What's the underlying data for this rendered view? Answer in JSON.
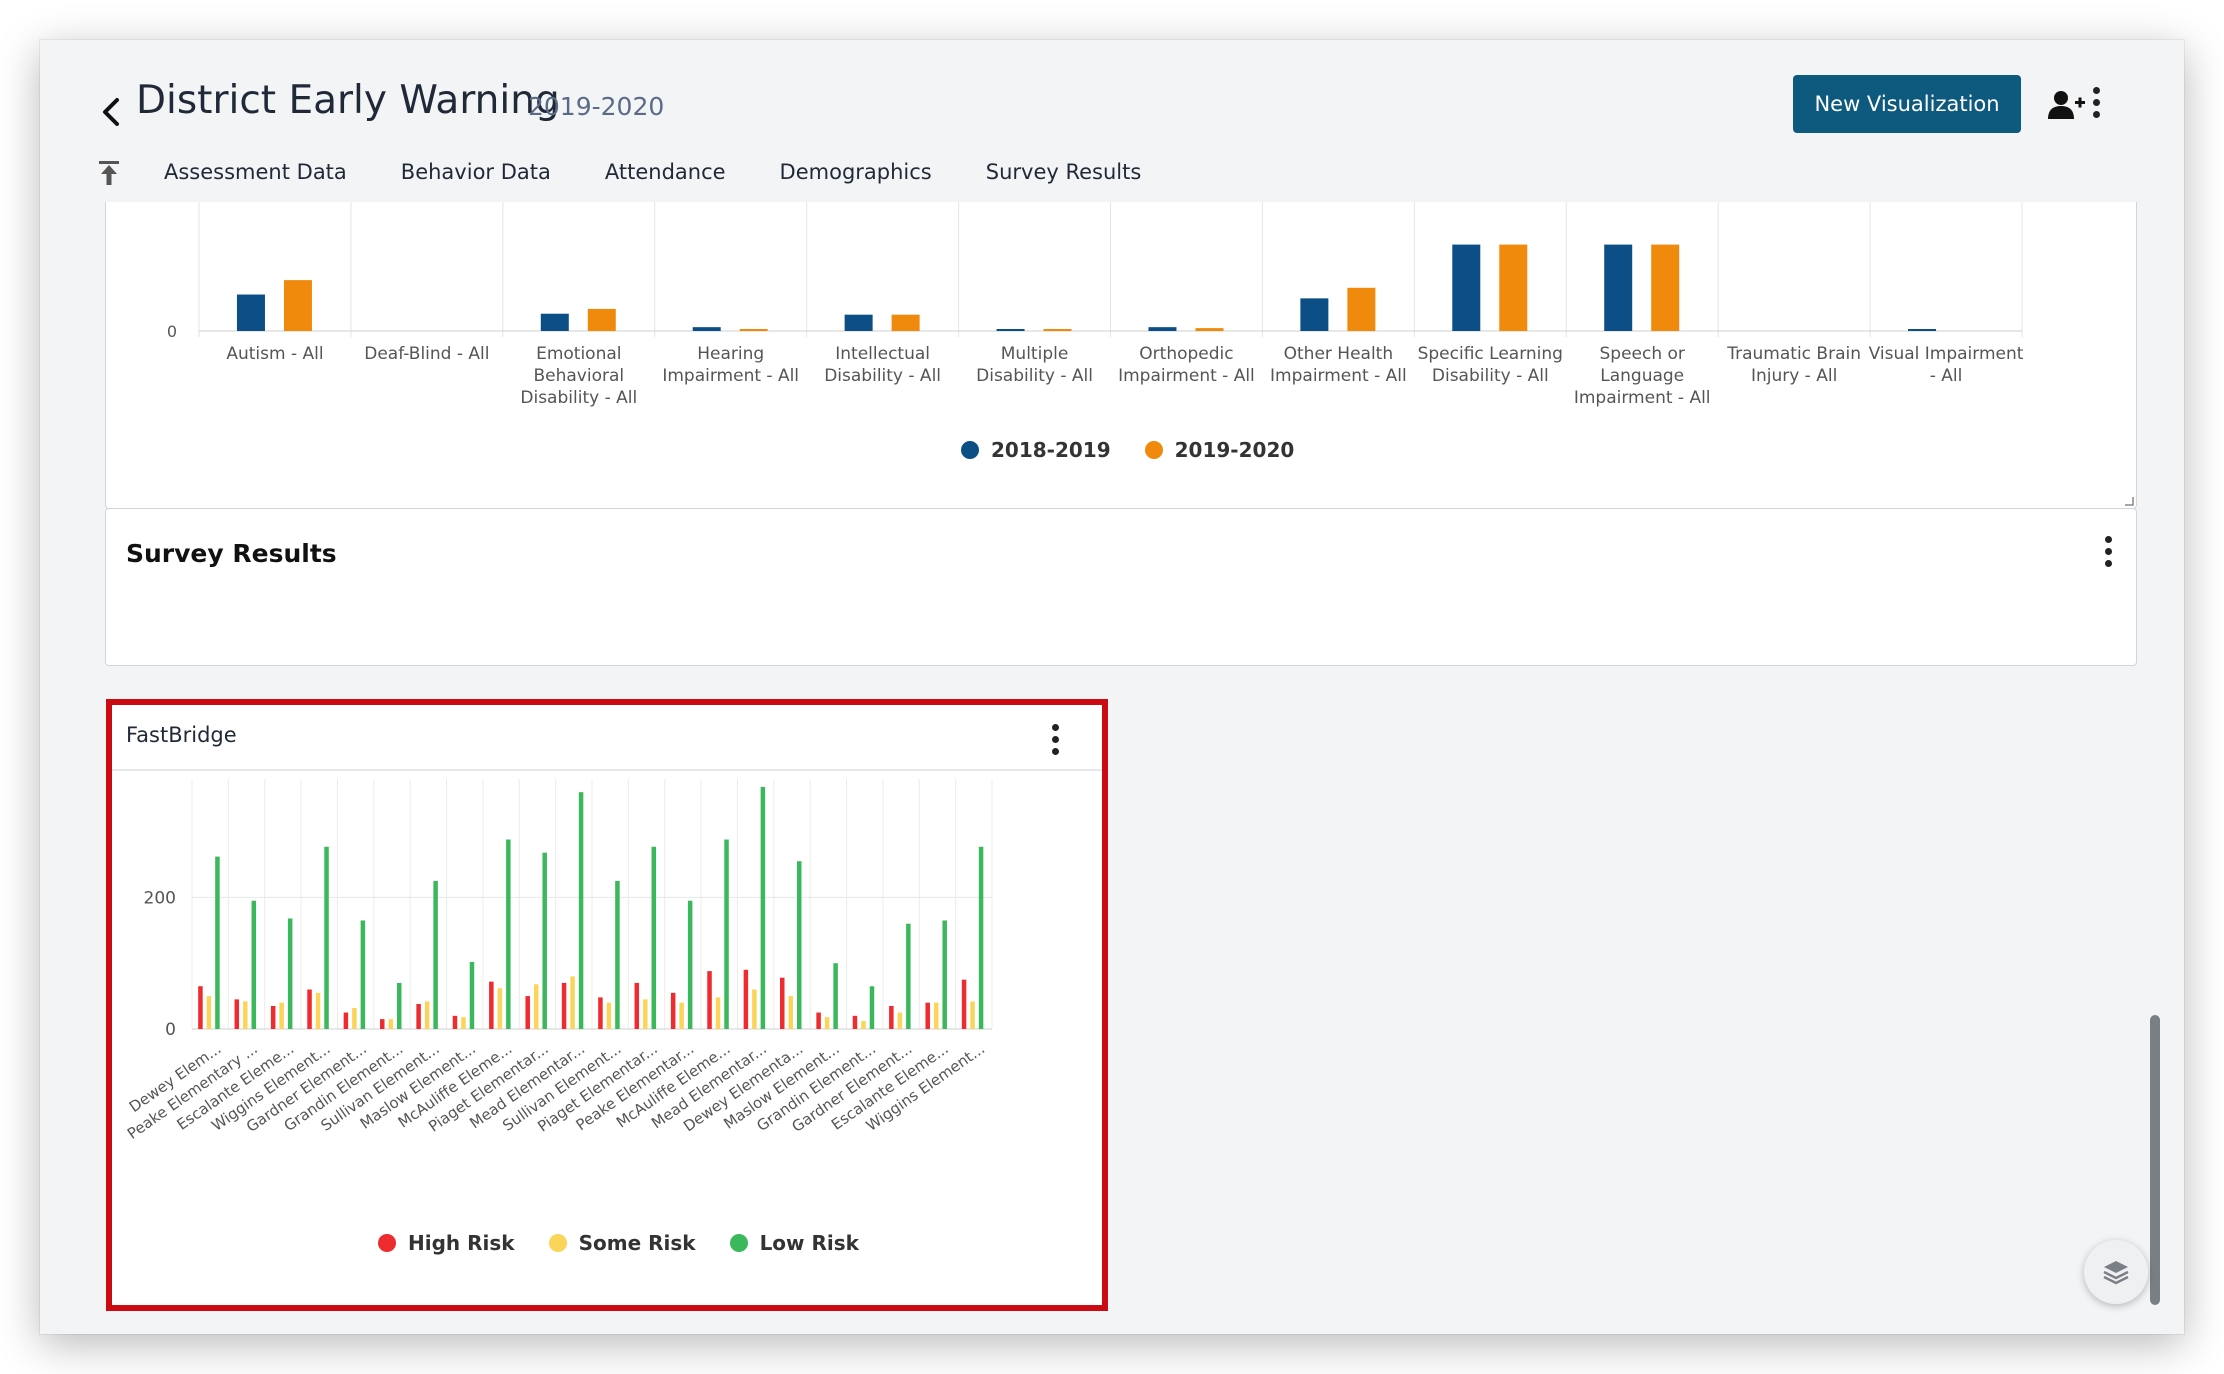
{
  "header": {
    "title": "District Early Warning",
    "subtitle": "2019-2020",
    "new_viz_label": "New Visualization"
  },
  "tabs": [
    {
      "label": "Assessment Data"
    },
    {
      "label": "Behavior Data"
    },
    {
      "label": "Attendance"
    },
    {
      "label": "Demographics"
    },
    {
      "label": "Survey Results"
    }
  ],
  "icons": {
    "back": "chevron-left-icon",
    "collapse": "collapse-up-icon",
    "add_user": "add-user-icon",
    "more": "kebab-menu-icon",
    "layers": "layers-icon"
  },
  "colors": {
    "primary_button": "#0d5a7e",
    "series_2018_2019": "#0b4f86",
    "series_2019_2020": "#f08a0c",
    "high_risk": "#ee2b2f",
    "some_risk": "#fbd45a",
    "low_risk": "#3cb85c",
    "highlight_border": "#cc0a12"
  },
  "survey_card": {
    "title": "Survey Results"
  },
  "fastbridge_card": {
    "title": "FastBridge"
  },
  "chart_data": [
    {
      "type": "bar",
      "categories": [
        "Autism - All",
        "Deaf-Blind - All",
        "Emotional Behavioral Disability - All",
        "Hearing Impairment - All",
        "Intellectual Disability - All",
        "Multiple Disability - All",
        "Orthopedic Impairment - All",
        "Other Health Impairment - All",
        "Specific Learning Disability - All",
        "Speech or Language Impairment - All",
        "Traumatic Brain Injury - All",
        "Visual Impairment - All"
      ],
      "series": [
        {
          "name": "2018-2019",
          "values": [
            38,
            0,
            18,
            4,
            17,
            2,
            4,
            34,
            90,
            90,
            0,
            1
          ]
        },
        {
          "name": "2019-2020",
          "values": [
            53,
            0,
            23,
            1,
            17,
            1,
            3,
            45,
            90,
            90,
            0,
            0
          ]
        }
      ],
      "yticks": [
        0
      ],
      "legend_position": "bottom",
      "note": "chart is scrolled; only the lower part of the plot area and the 0 tick are visible"
    },
    {
      "type": "bar",
      "categories": [
        "Dewey Elem...",
        "Peake Elementary ...",
        "Escalante Eleme...",
        "Wiggins Element...",
        "Gardner Element...",
        "Grandin Element...",
        "Sullivan Element...",
        "Maslow Element...",
        "McAuliffe Eleme...",
        "Piaget Elementar...",
        "Mead Elementar...",
        "Sullivan Element...",
        "Piaget Elementar...",
        "Peake Elementar...",
        "McAuliffe Eleme...",
        "Mead Elementar...",
        "Dewey Elementa...",
        "Maslow Element...",
        "Grandin Element...",
        "Gardner Element...",
        "Escalante Eleme...",
        "Wiggins Element..."
      ],
      "series": [
        {
          "name": "High Risk",
          "values": [
            65,
            45,
            35,
            60,
            25,
            15,
            38,
            20,
            72,
            50,
            70,
            48,
            70,
            55,
            88,
            90,
            78,
            25,
            20,
            35,
            40,
            75
          ]
        },
        {
          "name": "Some Risk",
          "values": [
            50,
            42,
            40,
            55,
            32,
            15,
            42,
            18,
            62,
            68,
            80,
            40,
            45,
            40,
            48,
            60,
            50,
            18,
            12,
            25,
            40,
            42
          ]
        },
        {
          "name": "Low Risk",
          "values": [
            262,
            195,
            168,
            277,
            165,
            70,
            225,
            102,
            288,
            268,
            360,
            225,
            277,
            195,
            288,
            368,
            255,
            100,
            65,
            160,
            165,
            277
          ]
        }
      ],
      "ylim": [
        0,
        380
      ],
      "yticks": [
        0,
        200
      ],
      "legend_position": "bottom"
    }
  ]
}
